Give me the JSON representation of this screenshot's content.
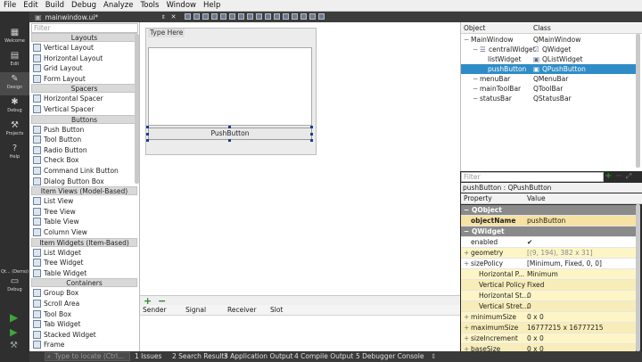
{
  "menubar": [
    "File",
    "Edit",
    "Build",
    "Debug",
    "Analyze",
    "Tools",
    "Window",
    "Help"
  ],
  "modes": [
    {
      "label": "Welcome",
      "icon": "grid-icon"
    },
    {
      "label": "Edit",
      "icon": "document-icon"
    },
    {
      "label": "Design",
      "icon": "pencil-icon"
    },
    {
      "label": "Debug",
      "icon": "bug-icon"
    },
    {
      "label": "Projects",
      "icon": "wrench-icon"
    },
    {
      "label": "Help",
      "icon": "question-icon"
    }
  ],
  "kit": {
    "label": "Qt... (Demo)",
    "sub": "Debug"
  },
  "doc": {
    "filename": "mainwindow.ui*"
  },
  "widgetbox": {
    "filter_placeholder": "Filter",
    "sections": [
      {
        "title": "Layouts",
        "items": [
          "Vertical Layout",
          "Horizontal Layout",
          "Grid Layout",
          "Form Layout"
        ]
      },
      {
        "title": "Spacers",
        "items": [
          "Horizontal Spacer",
          "Vertical Spacer"
        ]
      },
      {
        "title": "Buttons",
        "items": [
          "Push Button",
          "Tool Button",
          "Radio Button",
          "Check Box",
          "Command Link Button",
          "Dialog Button Box"
        ]
      },
      {
        "title": "Item Views (Model-Based)",
        "items": [
          "List View",
          "Tree View",
          "Table View",
          "Column View"
        ]
      },
      {
        "title": "Item Widgets (Item-Based)",
        "items": [
          "List Widget",
          "Tree Widget",
          "Table Widget"
        ]
      },
      {
        "title": "Containers",
        "items": [
          "Group Box",
          "Scroll Area",
          "Tool Box",
          "Tab Widget",
          "Stacked Widget",
          "Frame"
        ]
      }
    ]
  },
  "form": {
    "menu_placeholder": "Type Here",
    "button_label": "PushButton"
  },
  "signals": {
    "columns": [
      "Sender",
      "Signal",
      "Receiver",
      "Slot"
    ]
  },
  "object_inspector": {
    "columns": [
      "Object",
      "Class"
    ],
    "rows": [
      {
        "object": "MainWindow",
        "class": "QMainWindow",
        "indent": 0,
        "selected": false
      },
      {
        "object": "centralWidget",
        "class": "QWidget",
        "indent": 1,
        "selected": false
      },
      {
        "object": "listWidget",
        "class": "QListWidget",
        "indent": 2,
        "selected": false
      },
      {
        "object": "pushButton",
        "class": "QPushButton",
        "indent": 2,
        "selected": true
      },
      {
        "object": "menuBar",
        "class": "QMenuBar",
        "indent": 1,
        "selected": false
      },
      {
        "object": "mainToolBar",
        "class": "QToolBar",
        "indent": 1,
        "selected": false
      },
      {
        "object": "statusBar",
        "class": "QStatusBar",
        "indent": 1,
        "selected": false
      }
    ]
  },
  "property_editor": {
    "filter_placeholder": "Filter",
    "object_title": "pushButton : QPushButton",
    "columns": [
      "Property",
      "Value"
    ],
    "rows": [
      {
        "name": "QObject",
        "value": "",
        "style": "grp"
      },
      {
        "name": "objectName",
        "value": "pushButton",
        "style": "hl"
      },
      {
        "name": "QWidget",
        "value": "",
        "style": "grp"
      },
      {
        "name": "enabled",
        "value": "✔",
        "style": "white"
      },
      {
        "name": "geometry",
        "value": "[(9, 194), 382 x 31]",
        "style": "yel"
      },
      {
        "name": "sizePolicy",
        "value": "[Minimum, Fixed, 0, 0]",
        "style": "white"
      },
      {
        "name": "Horizontal P...",
        "value": "Minimum",
        "style": "yel"
      },
      {
        "name": "Vertical Policy",
        "value": "Fixed",
        "style": "yel2"
      },
      {
        "name": "Horizontal St...",
        "value": "0",
        "style": "yel"
      },
      {
        "name": "Vertical Stret...",
        "value": "0",
        "style": "yel2"
      },
      {
        "name": "minimumSize",
        "value": "0 x 0",
        "style": "yel"
      },
      {
        "name": "maximumSize",
        "value": "16777215 x 16777215",
        "style": "yel2"
      },
      {
        "name": "sizeIncrement",
        "value": "0 x 0",
        "style": "yel"
      },
      {
        "name": "baseSize",
        "value": "0 x 0",
        "style": "yel2"
      }
    ]
  },
  "statusbar": {
    "locate_placeholder": "Type to locate (Ctrl...",
    "tabs": [
      "1 Issues",
      "2 Search Results",
      "3 Application Output",
      "4 Compile Output",
      "5 Debugger Console"
    ]
  },
  "colors": {
    "selection": "#308cc6",
    "group_header": "#8a8a8a",
    "property_highlight": "#fdf5c6"
  }
}
